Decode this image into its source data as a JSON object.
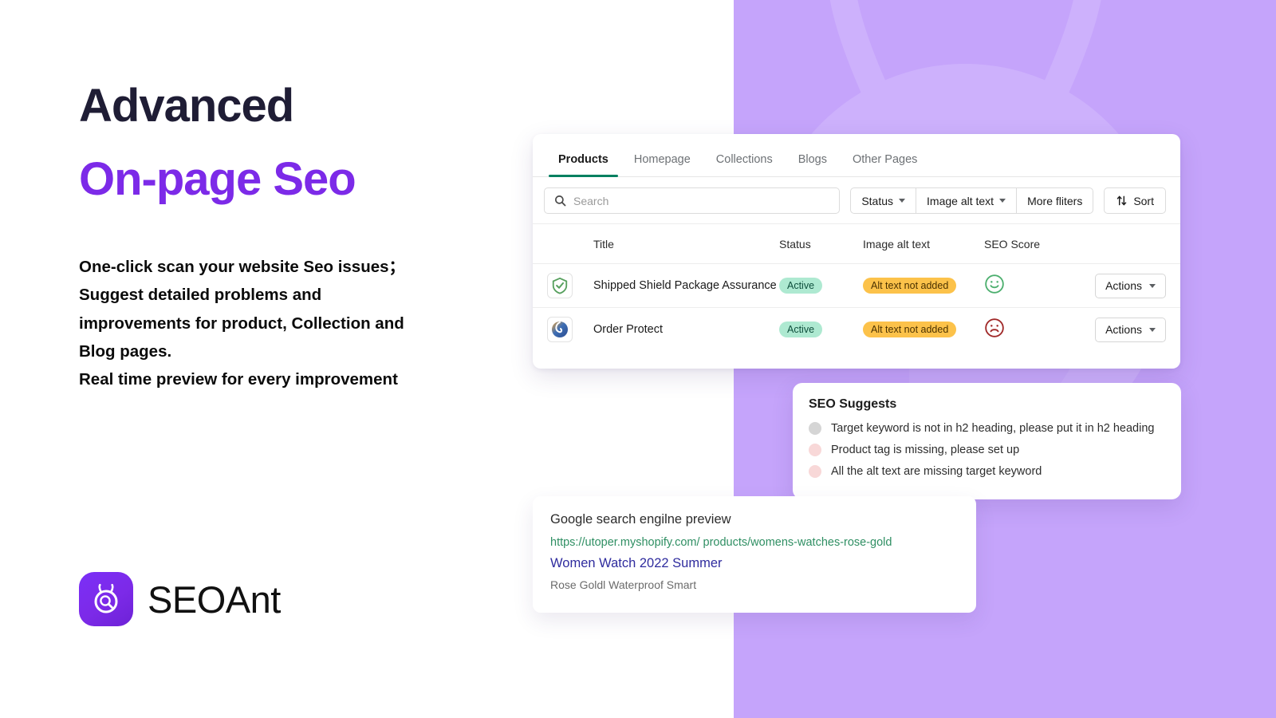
{
  "hero": {
    "headline_line1": "Advanced",
    "headline_line2": "On-page Seo",
    "body_lines": [
      "One-click scan your website Seo issues；",
      "Suggest detailed problems and",
      "improvements for product, Collection and",
      "Blog pages.",
      "Real time preview for every improvement"
    ],
    "brand_name": "SEOAnt",
    "brand_icon": "ant-magnifier-icon",
    "accent_color": "#7c2ae8",
    "headline_color": "#1f1d35"
  },
  "background": {
    "panel_color": "#c5a4fb",
    "watermark_icon": "ant-head-watermark-icon"
  },
  "app": {
    "tabs": [
      {
        "label": "Products",
        "active": true
      },
      {
        "label": "Homepage",
        "active": false
      },
      {
        "label": "Collections",
        "active": false
      },
      {
        "label": "Blogs",
        "active": false
      },
      {
        "label": "Other Pages",
        "active": false
      }
    ],
    "active_tab_color": "#008060",
    "search": {
      "placeholder": "Search",
      "value": "",
      "icon": "search-icon"
    },
    "filters": [
      {
        "label": "Status",
        "has_caret": true
      },
      {
        "label": "Image alt text",
        "has_caret": true
      },
      {
        "label": "More fliters",
        "has_caret": false
      }
    ],
    "sort": {
      "label": "Sort",
      "icon": "sort-arrows-icon"
    },
    "table": {
      "columns": [
        "Title",
        "Status",
        "Image alt text",
        "SEO Score"
      ],
      "rows": [
        {
          "thumb_icon": "green-shield-check-icon",
          "title": "Shipped Shield Package Assurance",
          "status": "Active",
          "alt_text": "Alt text not added",
          "seo_score_icon": "smiley-happy-icon",
          "seo_score_color": "#4caf6e",
          "actions_label": "Actions"
        },
        {
          "thumb_icon": "blue-swirl-icon",
          "title": "Order Protect",
          "status": "Active",
          "alt_text": "Alt text not added",
          "seo_score_icon": "smiley-sad-icon",
          "seo_score_color": "#a02828",
          "actions_label": "Actions"
        }
      ]
    }
  },
  "suggests": {
    "title": "SEO Suggests",
    "items": [
      {
        "text": "Target keyword is not in h2 heading, please put it in h2 heading",
        "dot_color": "#d5d5d5"
      },
      {
        "text": "Product tag is missing, please set up",
        "dot_color": "#f8d8d8"
      },
      {
        "text": "All the alt text are missing target keyword",
        "dot_color": "#f8d8d8"
      }
    ]
  },
  "google_preview": {
    "heading": "Google search engilne preview",
    "url": "https://utoper.myshopify.com/ products/womens-watches-rose-gold",
    "title": "Women Watch 2022 Summer",
    "description": "Rose Goldl Waterproof Smart"
  }
}
